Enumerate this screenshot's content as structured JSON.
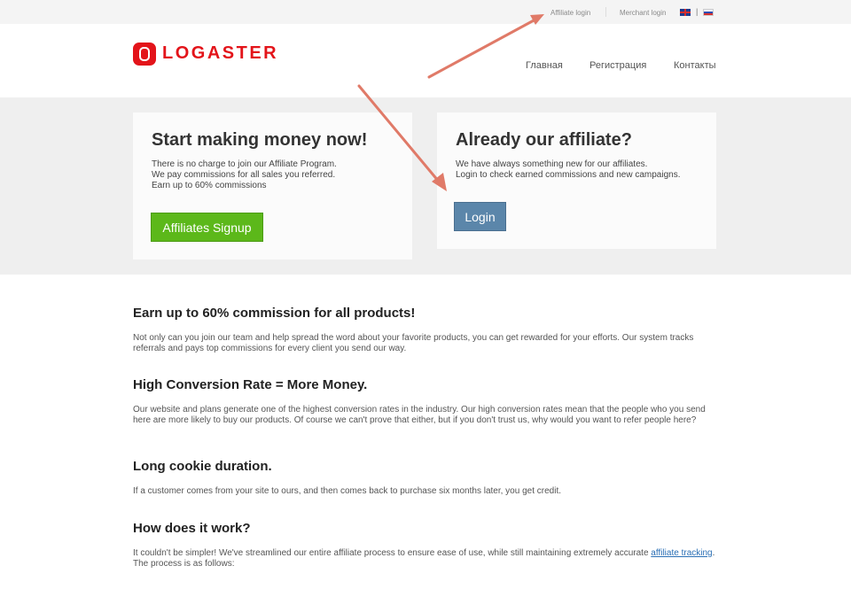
{
  "topbar": {
    "affiliate_login": "Affiliate login",
    "merchant_login": "Merchant login",
    "lang_divider": "|"
  },
  "logo": {
    "text": "LOGASTER"
  },
  "nav": {
    "items": [
      {
        "label": "Главная"
      },
      {
        "label": "Регистрация"
      },
      {
        "label": "Контакты"
      }
    ]
  },
  "signup_card": {
    "title": "Start making money now!",
    "text": "There is no charge to join our Affiliate Program.\nWe pay commissions for all sales you referred.\nEarn up to 60% commissions",
    "button": "Affiliates Signup"
  },
  "login_card": {
    "title": "Already our affiliate?",
    "text": "We have always something new for our affiliates.\nLogin to check earned commissions and new campaigns.",
    "button": "Login"
  },
  "sections": [
    {
      "title": "Earn up to 60% commission for all products!",
      "text": "Not only can you join our team and help spread the word about your favorite products, you can get rewarded for your efforts. Our system tracks referrals and pays top commissions for every client you send our way."
    },
    {
      "title": "High Conversion Rate = More Money.",
      "text": "Our website and plans generate one of the highest conversion rates in the industry. Our high conversion rates mean that the people who you send here are more likely to buy our products. Of course we can't prove that either, but if you don't trust us, why would you want to refer people here?"
    },
    {
      "title": "Long cookie duration.",
      "text": "If a customer comes from your site to ours, and then comes back to purchase six months later, you get credit."
    },
    {
      "title": "How does it work?",
      "text_before": "It couldn't be simpler! We've streamlined our entire affiliate process to ensure ease of use, while still maintaining extremely accurate ",
      "link": "affiliate tracking",
      "text_after": ". The process is as follows:"
    }
  ],
  "colors": {
    "brand": "#e3141a",
    "signup_button": "#5cb81a",
    "login_button": "#5b86aa",
    "annotation_arrow": "#e07a68"
  }
}
